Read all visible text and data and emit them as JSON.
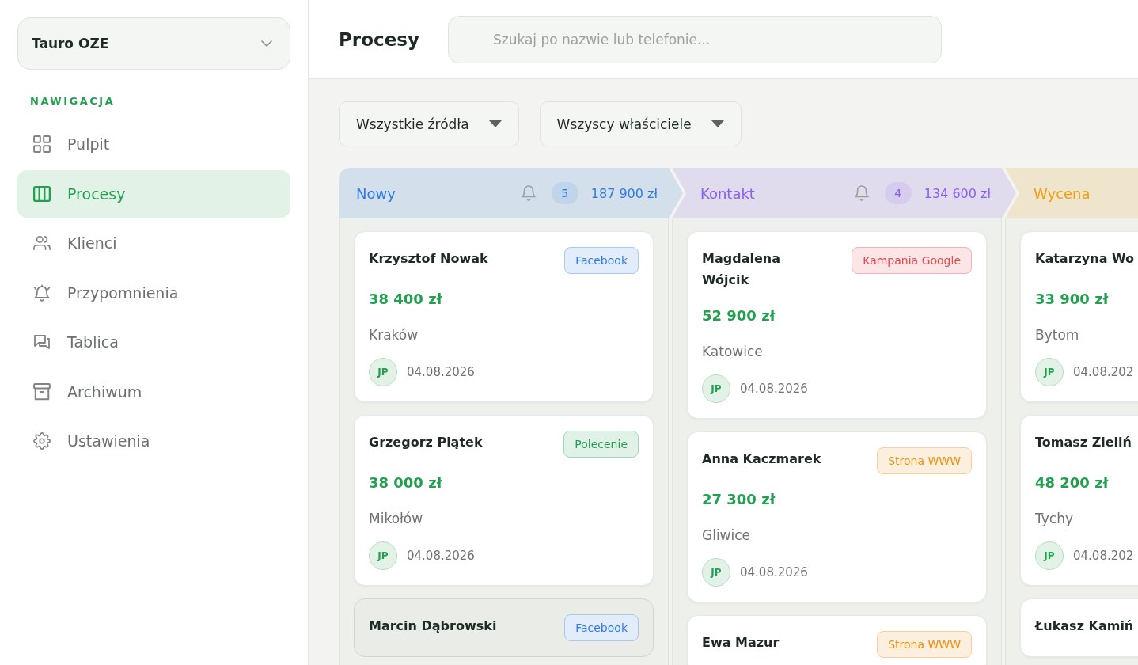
{
  "sidebar": {
    "workspace": "Tauro OZE",
    "section_label": "NAWIGACJA",
    "items": [
      {
        "label": "Pulpit",
        "selected": false
      },
      {
        "label": "Procesy",
        "selected": true
      },
      {
        "label": "Klienci",
        "selected": false
      },
      {
        "label": "Przypomnienia",
        "selected": false
      },
      {
        "label": "Tablica",
        "selected": false
      },
      {
        "label": "Archiwum",
        "selected": false
      },
      {
        "label": "Ustawienia",
        "selected": false
      }
    ]
  },
  "header": {
    "title": "Procesy",
    "search": {
      "placeholder": "Szukaj po nazwie lub telefonie..."
    }
  },
  "filters": [
    {
      "label": "Wszystkie źródła"
    },
    {
      "label": "Wszyscy właściciele"
    }
  ],
  "columns": [
    {
      "name": "Nowy",
      "color": "#2f7ae5",
      "count": "5",
      "total": "187 900 zł",
      "cards": [
        {
          "name": "Krzysztof Nowak",
          "tag": {
            "label": "Facebook",
            "color": "#2f7ae5"
          },
          "amount": "38 400 zł",
          "city": "Kraków",
          "owner": "JP",
          "date": "04.08.2026",
          "selected": false
        },
        {
          "name": "Grzegorz Piątek",
          "tag": {
            "label": "Polecenie",
            "color": "#22a050"
          },
          "amount": "38 000 zł",
          "city": "Mikołów",
          "owner": "JP",
          "date": "04.08.2026",
          "selected": false
        },
        {
          "name": "Marcin Dąbrowski",
          "tag": {
            "label": "Facebook",
            "color": "#2f7ae5"
          },
          "selected": true
        }
      ]
    },
    {
      "name": "Kontakt",
      "color": "#8b5cf6",
      "count": "4",
      "total": "134 600 zł",
      "cards": [
        {
          "name": "Magdalena Wójcik",
          "tag": {
            "label": "Kampania Google",
            "color": "#e5484d"
          },
          "amount": "52 900 zł",
          "city": "Katowice",
          "owner": "JP",
          "date": "04.08.2026",
          "selected": false
        },
        {
          "name": "Anna Kaczmarek",
          "tag": {
            "label": "Strona WWW",
            "color": "#f0900f"
          },
          "amount": "27 300 zł",
          "city": "Gliwice",
          "owner": "JP",
          "date": "04.08.2026",
          "selected": false
        },
        {
          "name": "Ewa Mazur",
          "tag": {
            "label": "Strona WWW",
            "color": "#f0900f"
          },
          "selected": false
        }
      ]
    },
    {
      "name": "Wycena",
      "color": "#f59e0b",
      "cards": [
        {
          "name": "Katarzyna Wo",
          "amount": "33 900 zł",
          "city": "Bytom",
          "owner": "JP",
          "date": "04.08.202",
          "selected": false
        },
        {
          "name": "Tomasz Zieliń",
          "amount": "48 200 zł",
          "city": "Tychy",
          "owner": "JP",
          "date": "04.08.202",
          "selected": false
        },
        {
          "name": "Łukasz Kamiń",
          "selected": false
        }
      ]
    }
  ]
}
